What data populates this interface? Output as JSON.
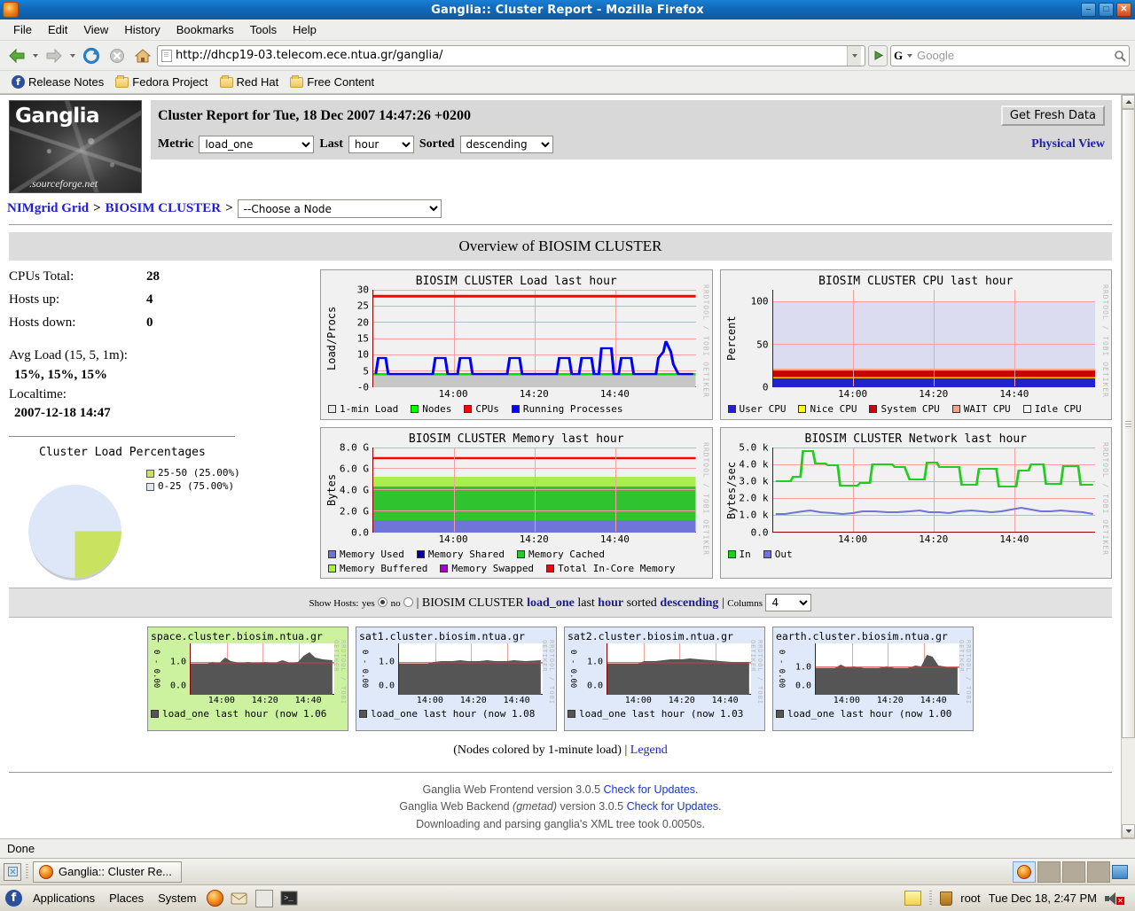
{
  "window": {
    "title": "Ganglia:: Cluster Report - Mozilla Firefox",
    "minimize": "–",
    "maximize": "□",
    "close": "✕"
  },
  "menu": [
    "File",
    "Edit",
    "View",
    "History",
    "Bookmarks",
    "Tools",
    "Help"
  ],
  "toolbar": {
    "url": "http://dhcp19-03.telecom.ece.ntua.gr/ganglia/",
    "search_placeholder": "Google",
    "search_engine": "G",
    "back_icon": "back-arrow-icon",
    "forward_icon": "forward-arrow-icon",
    "reload_icon": "reload-icon",
    "stop_icon": "stop-icon",
    "home_icon": "home-icon",
    "go_icon": "go-icon"
  },
  "bookmarks": [
    {
      "label": "Release Notes",
      "icon": "fedora-icon"
    },
    {
      "label": "Fedora Project",
      "icon": "folder-icon"
    },
    {
      "label": "Red Hat",
      "icon": "folder-icon"
    },
    {
      "label": "Free Content",
      "icon": "folder-icon"
    }
  ],
  "ganglia": {
    "logo_name": "Ganglia",
    "logo_sub": ".sourceforge.net",
    "report_title": "Cluster Report for Tue, 18 Dec 2007 14:47:26 +0200",
    "fresh_button": "Get Fresh Data",
    "physical_view": "Physical View",
    "controls": {
      "metric_label": "Metric",
      "metric_value": "load_one",
      "last_label": "Last",
      "last_value": "hour",
      "sorted_label": "Sorted",
      "sorted_value": "descending"
    },
    "breadcrumb": {
      "grid": "NIMgrid Grid",
      "sep1": ">",
      "cluster": "BIOSIM CLUSTER",
      "sep2": ">",
      "node_select": "--Choose a Node"
    },
    "overview_heading": "Overview of BIOSIM CLUSTER"
  },
  "stats": {
    "rows": [
      {
        "label": "CPUs Total:",
        "value": "28"
      },
      {
        "label": "Hosts up:",
        "value": "4"
      },
      {
        "label": "Hosts down:",
        "value": "0"
      }
    ],
    "avg_label": "Avg Load (15, 5, 1m):",
    "avg_value": "15%, 15%, 15%",
    "localtime_label": "Localtime:",
    "localtime_value": "2007-12-18 14:47"
  },
  "chart_data": [
    {
      "type": "pie",
      "title": "Cluster Load Percentages",
      "slices": [
        {
          "label": "25-50 (25.00%)",
          "value": 25.0,
          "color": "#c9e25f"
        },
        {
          "label": "0-25 (75.00%)",
          "value": 75.0,
          "color": "#dde7f7"
        }
      ],
      "legend": "right"
    },
    {
      "type": "line",
      "title": "BIOSIM CLUSTER Load last hour",
      "ylabel": "Load/Procs",
      "ylim": [
        0,
        30
      ],
      "yticks": [
        "-0",
        "5",
        "10",
        "15",
        "20",
        "25",
        "30"
      ],
      "xticks": [
        "14:00",
        "14:20",
        "14:40"
      ],
      "grid": true,
      "series": [
        {
          "name": "1-min Load",
          "color": "#cccccc",
          "type": "area",
          "values": [
            4.2,
            4.2,
            4.2,
            4.2,
            4.2,
            4.2,
            4.2,
            4.2,
            4.2,
            4.2,
            4.2,
            4.2
          ]
        },
        {
          "name": "Nodes",
          "color": "#00ff00",
          "type": "line",
          "values": [
            4,
            4,
            4,
            4,
            4,
            4,
            4,
            4,
            4,
            4,
            4,
            4
          ]
        },
        {
          "name": "CPUs",
          "color": "#ff0000",
          "type": "line",
          "values": [
            28,
            28,
            28,
            28,
            28,
            28,
            28,
            28,
            28,
            28,
            28,
            28
          ]
        },
        {
          "name": "Running Processes",
          "color": "#0000ff",
          "type": "line",
          "values": [
            5,
            4,
            5,
            5,
            4,
            5,
            5,
            5,
            6,
            5,
            7,
            4
          ]
        }
      ]
    },
    {
      "type": "area",
      "title": "BIOSIM CLUSTER CPU last hour",
      "ylabel": "Percent",
      "ylim": [
        0,
        100
      ],
      "yticks": [
        "0",
        "50",
        "100"
      ],
      "xticks": [
        "14:00",
        "14:20",
        "14:40"
      ],
      "grid": true,
      "series": [
        {
          "name": "User CPU",
          "color": "#2222cc",
          "values": [
            7,
            7,
            7,
            7,
            7,
            7,
            7,
            7
          ]
        },
        {
          "name": "Nice CPU",
          "color": "#ffff00",
          "values": [
            0.3,
            0.3,
            0.3,
            0.3,
            0.3,
            0.3,
            0.3,
            0.3
          ]
        },
        {
          "name": "System CPU",
          "color": "#cc0000",
          "values": [
            9,
            9,
            9,
            9,
            9,
            9,
            9,
            9
          ]
        },
        {
          "name": "WAIT CPU",
          "color": "#ffa080",
          "values": [
            0.2,
            0.2,
            0.2,
            0.2,
            0.2,
            0.2,
            0.2,
            0.2
          ]
        },
        {
          "name": "Idle CPU",
          "color": "#dcdcf0",
          "values": [
            83,
            83,
            83,
            83,
            83,
            83,
            83,
            83
          ]
        }
      ]
    },
    {
      "type": "area",
      "title": "BIOSIM CLUSTER Memory last hour",
      "ylabel": "Bytes",
      "ylim": [
        0,
        8
      ],
      "yticks": [
        "0.0",
        "2.0 G",
        "4.0 G",
        "6.0 G",
        "8.0 G"
      ],
      "xticks": [
        "14:00",
        "14:20",
        "14:40"
      ],
      "grid": true,
      "series": [
        {
          "name": "Memory Used",
          "color": "#6f74d8",
          "values": [
            1.15,
            1.15,
            1.15,
            1.15,
            1.15,
            1.15,
            1.15,
            1.15
          ]
        },
        {
          "name": "Memory Shared",
          "color": "#000099",
          "values": [
            0,
            0,
            0,
            0,
            0,
            0,
            0,
            0
          ]
        },
        {
          "name": "Memory Cached",
          "color": "#2fc42f",
          "values": [
            3.15,
            3.15,
            3.15,
            3.15,
            3.15,
            3.15,
            3.15,
            3.15
          ]
        },
        {
          "name": "Memory Buffered",
          "color": "#a6ef4f",
          "values": [
            0.9,
            0.9,
            0.9,
            0.9,
            0.9,
            0.9,
            0.9,
            0.9
          ]
        },
        {
          "name": "Memory Swapped",
          "color": "#aa00cc",
          "values": [
            0,
            0,
            0,
            0,
            0,
            0,
            0,
            0
          ]
        },
        {
          "name": "Total In-Core Memory",
          "color": "#ff0000",
          "type": "line",
          "values": [
            7.0,
            7.0,
            7.0,
            7.0,
            7.0,
            7.0,
            7.0,
            7.0
          ]
        }
      ]
    },
    {
      "type": "line",
      "title": "BIOSIM CLUSTER Network last hour",
      "ylabel": "Bytes/sec",
      "ylim": [
        0,
        5000
      ],
      "yticks": [
        "0.0",
        "1.0 k",
        "2.0 k",
        "3.0 k",
        "4.0 k",
        "5.0 k"
      ],
      "xticks": [
        "14:00",
        "14:20",
        "14:40"
      ],
      "grid": true,
      "series": [
        {
          "name": "In",
          "color": "#22cc22",
          "values": [
            3000,
            3000,
            3250,
            4800,
            4050,
            3950,
            2750,
            2800,
            2900,
            4000,
            4000,
            3800,
            3100,
            3150,
            4100,
            3850,
            3850,
            2800,
            2700,
            3800,
            3900,
            3800,
            2600,
            2650,
            3700,
            4000,
            3950,
            2850,
            2850,
            3800,
            3950,
            2800
          ]
        },
        {
          "name": "Out",
          "color": "#6f74d8",
          "values": [
            1100,
            1120,
            1150,
            1200,
            1230,
            1180,
            1150,
            1130,
            1120,
            1180,
            1180,
            1150,
            1160,
            1200,
            1210,
            1180,
            1170,
            1130,
            1150,
            1230,
            1200,
            1170,
            1150,
            1180,
            1250,
            1320,
            1280,
            1200,
            1180,
            1230,
            1200,
            1130
          ]
        }
      ]
    }
  ],
  "hostbar": {
    "show_hosts_label": "Show Hosts:",
    "yes_label": "yes",
    "no_label": "no",
    "sep": "|",
    "cluster": "BIOSIM CLUSTER",
    "metric": "load_one",
    "last_word": "last",
    "period": "hour",
    "sorted_word": "sorted",
    "sort_dir": "descending",
    "columns_label": "Columns",
    "columns_value": "4"
  },
  "nodes": [
    {
      "name": "space.cluster.biosim.ntua.gr",
      "legend": "load_one last hour (now 1.06",
      "now": "1.06",
      "color": "hot",
      "yticks": [
        "0.0",
        "1.0"
      ],
      "xticks": [
        "14:00",
        "14:20",
        "14:40"
      ],
      "rot_label": "0 - 0.00"
    },
    {
      "name": "sat1.cluster.biosim.ntua.gr",
      "legend": "load_one last hour (now 1.08",
      "now": "1.08",
      "color": "cool",
      "yticks": [
        "0.0",
        "1.0"
      ],
      "xticks": [
        "14:00",
        "14:20",
        "14:40"
      ],
      "rot_label": "0 - 0.00"
    },
    {
      "name": "sat2.cluster.biosim.ntua.gr",
      "legend": "load_one last hour (now 1.03",
      "now": "1.03",
      "color": "cool",
      "yticks": [
        "0.0",
        "1.0"
      ],
      "xticks": [
        "14:00",
        "14:20",
        "14:40"
      ],
      "rot_label": "0 - 0.00"
    },
    {
      "name": "earth.cluster.biosim.ntua.gr",
      "legend": "load_one last hour (now 1.00",
      "now": "1.00",
      "color": "cool",
      "yticks": [
        "0.0",
        "1.0"
      ],
      "xticks": [
        "14:00",
        "14:20",
        "14:40"
      ],
      "rot_label": "0 - 0.00"
    }
  ],
  "nodes_footer": {
    "text": "(Nodes colored by 1-minute load) |",
    "legend_link": "Legend"
  },
  "footer": {
    "line1_a": "Ganglia Web Frontend version 3.0.5 ",
    "line1_link": "Check for Updates.",
    "line2_a": "Ganglia Web Backend ",
    "line2_em": "(gmetad)",
    "line2_b": " version 3.0.5 ",
    "line2_link": "Check for Updates.",
    "line3": "Downloading and parsing ganglia's XML tree took 0.0050s."
  },
  "status": {
    "text": "Done"
  },
  "taskbar": {
    "window_label": "Ganglia:: Cluster Re..."
  },
  "panel": {
    "applications": "Applications",
    "places": "Places",
    "system": "System",
    "user": "root",
    "clock": "Tue Dec 18,  2:47 PM"
  },
  "rrd_credit": "RRDTOOL / TOBI OETIKER"
}
